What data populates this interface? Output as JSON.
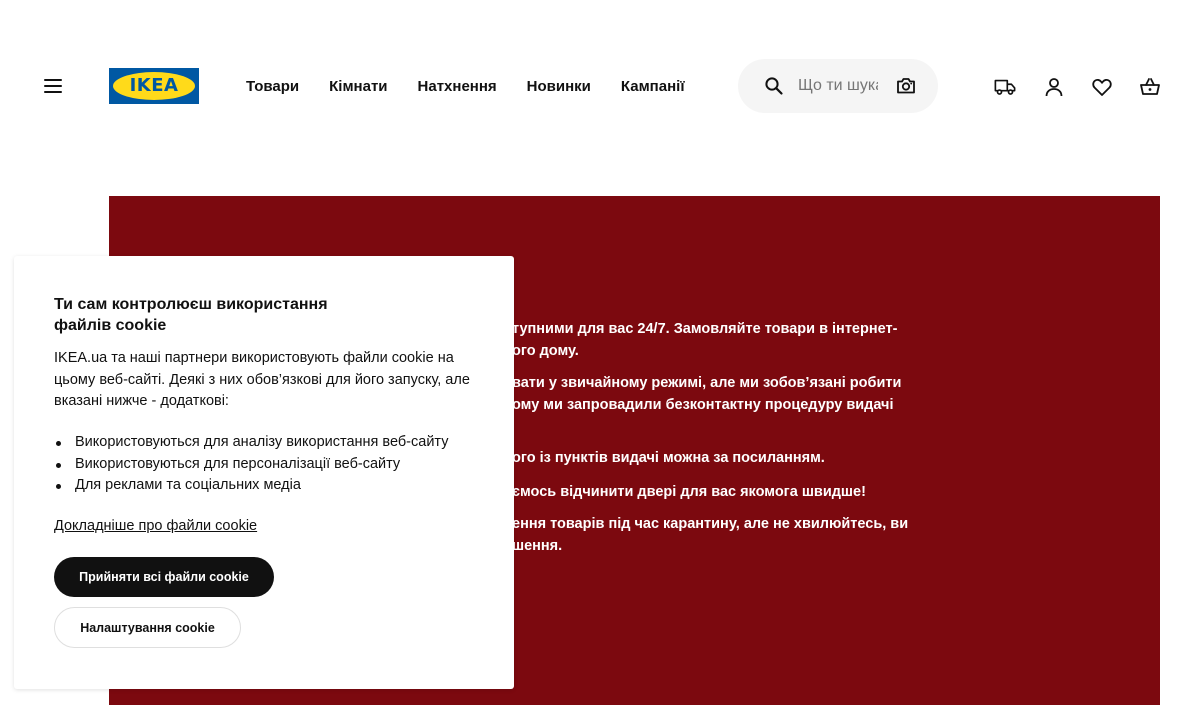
{
  "header": {
    "logo_text": "IKEA",
    "brand_colors": {
      "blue": "#0058a3",
      "yellow": "#ffda1a"
    },
    "nav": [
      {
        "label": "Товари"
      },
      {
        "label": "Кімнати"
      },
      {
        "label": "Натхнення"
      },
      {
        "label": "Новинки"
      },
      {
        "label": "Кампанії"
      }
    ],
    "search": {
      "placeholder": "Що ти шукаєш?",
      "icon": "search-icon",
      "camera_icon": "camera-icon"
    },
    "icons": [
      "menu-icon",
      "truck-icon",
      "user-icon",
      "heart-icon",
      "cart-icon"
    ]
  },
  "hero": {
    "background": "#7c090f",
    "lines": [
      "тупними для вас 24/7. Замовляйте товари в інтернет-",
      "ого дому.",
      "вати у звичайному режимі, але ми зобов’язані робити",
      "ому ми запровадили безконтактну процедуру видачі",
      "ого із пунктів видачі можна за посиланням.",
      "ємось відчинити двері для вас якомога швидше!",
      "ення товарів під час карантину, але не хвилюйтесь, ви",
      "шення."
    ]
  },
  "cookie": {
    "title": "Ти сам контролюєш використання файлів cookie",
    "intro": "IKEA.ua та наші партнери використовують файли cookie на цьому веб-сайті. Деякі з них обов’язкові для його запуску, але вказані нижче - додаткові:",
    "items": [
      "Використовуються для аналізу використання веб-сайту",
      "Використовуються для персоналізації веб-сайту",
      "Для реклами та соціальних медіа"
    ],
    "more_link": "Докладніше про файли cookie",
    "accept_button": "Прийняти всі файли cookie",
    "settings_button": "Налаштування cookie"
  }
}
